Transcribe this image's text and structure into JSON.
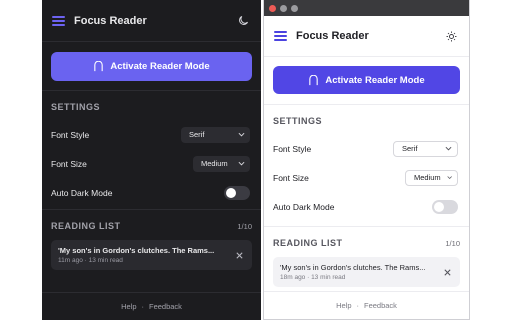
{
  "app": {
    "title": "Focus Reader"
  },
  "activate": {
    "label": "Activate Reader Mode"
  },
  "settings": {
    "title": "SETTINGS",
    "font_style": {
      "label": "Font Style",
      "value": "Serif"
    },
    "font_size": {
      "label": "Font Size",
      "value": "Medium"
    },
    "auto_dark": {
      "label": "Auto Dark Mode",
      "enabled": false
    }
  },
  "reading_list": {
    "title": "READING LIST",
    "count": "1/10",
    "items": [
      {
        "title": "'My son's in Gordon's clutches. The Rams...",
        "dark_meta": "11m ago · 13 min read",
        "light_meta": "18m ago · 13 min read"
      }
    ]
  },
  "footer": {
    "help": "Help",
    "separator": "·",
    "feedback": "Feedback"
  },
  "colors": {
    "accent_dark": "#6a63f0",
    "accent_light": "#5146e5",
    "dark_bg": "#1c1c1f",
    "light_bg": "#ffffff"
  },
  "icons": {
    "menu": "hamburger-icon",
    "dark_theme": "moon-icon",
    "light_theme": "sun-icon",
    "reader": "book-icon",
    "remove": "close-icon",
    "dropdown": "chevron-down-icon"
  }
}
